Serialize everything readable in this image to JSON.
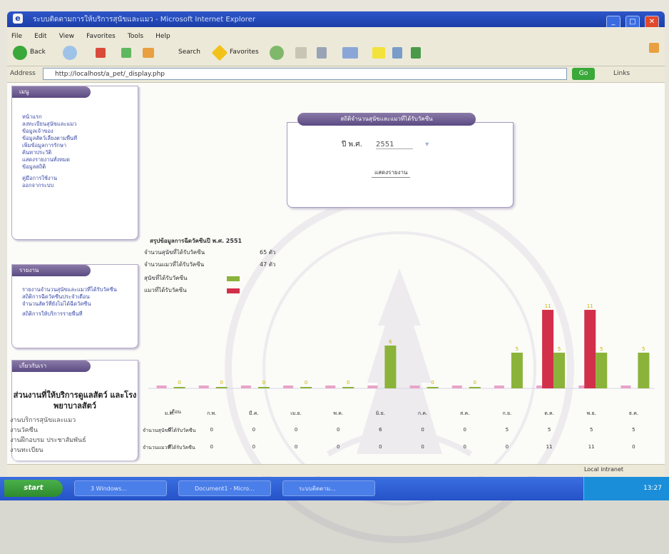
{
  "window": {
    "title": "ระบบติดตามการให้บริการสุนัขและแมว - Microsoft Internet Explorer",
    "controls": [
      "_",
      "□",
      "✕"
    ]
  },
  "menu": [
    "File",
    "Edit",
    "View",
    "Favorites",
    "Tools",
    "Help"
  ],
  "toolbar": {
    "back_label": "Back",
    "search_label": "Search",
    "favorites_label": "Favorites"
  },
  "address": {
    "label": "Address",
    "url": "http://localhost/a_pet/_display.php",
    "go_label": "Go",
    "links_label": "Links"
  },
  "sidebar": {
    "menu_box": {
      "header": "เมนู",
      "items": [
        "หน้าแรก",
        "ลงทะเบียนสุนัขและแมว",
        "ข้อมูลเจ้าของ",
        "ข้อมูลสัตว์เลี้ยงตามพื้นที่",
        "เพิ่มข้อมูลการรักษา",
        "ค้นหาประวัติ",
        "แสดงรายงานทั้งหมด",
        "ข้อมูลสถิติ",
        "คู่มือการใช้งาน",
        "ออกจากระบบ"
      ]
    },
    "report_box": {
      "header": "รายงาน",
      "items": [
        "รายงานจำนวนสุนัขและแมวที่ได้รับวัคซีน",
        "สถิติการฉีดวัคซีนประจำเดือน",
        "จำนวนสัตว์ที่ยังไม่ได้ฉีดวัคซีน",
        "สถิติการให้บริการรายพื้นที่"
      ]
    },
    "about_box": {
      "header": "เกี่ยวกับเรา"
    },
    "thai_heading": "ส่วนงานที่ให้บริการดูแลสัตว์ และโรงพยาบาลสัตว์",
    "thai_items": [
      "งานบริการสุนัขและแมว",
      "งานวัคซีน",
      "งานฝึกอบรม ประชาสัมพันธ์",
      "งานทะเบียน"
    ]
  },
  "panel": {
    "header": "สถิติจำนวนสุนัขและแมวที่ได้รับวัคซีน",
    "year_label": "ปี พ.ศ.",
    "year_value": "2551",
    "button_label": "แสดงรายงาน"
  },
  "summary": {
    "title": "สรุปข้อมูลการฉีดวัคซีนปี พ.ศ. 2551",
    "row1_label": "จำนวนสุนัขที่ได้รับวัคซีน",
    "row1_value": "65 ตัว",
    "row2_label": "จำนวนแมวที่ได้รับวัคซีน",
    "row2_value": "47 ตัว",
    "legend_dog": "สุนัขที่ได้รับวัคซีน",
    "legend_cat": "แมวที่ได้รับวัคซีน",
    "color_dog": "#8bb33a",
    "color_cat": "#d2304a",
    "color_pink": "#e8a3c8"
  },
  "chart_data": {
    "type": "bar",
    "categories": [
      "ม.ค.",
      "ก.พ.",
      "มี.ค.",
      "เม.ย.",
      "พ.ค.",
      "มิ.ย.",
      "ก.ค.",
      "ส.ค.",
      "ก.ย.",
      "ต.ค.",
      "พ.ย.",
      "ธ.ค."
    ],
    "series": [
      {
        "name": "สุนัขที่ได้รับวัคซีน",
        "values": [
          0,
          0,
          0,
          0,
          0,
          6,
          0,
          0,
          5,
          5,
          5,
          5
        ]
      },
      {
        "name": "แมวที่ได้รับวัคซีน",
        "values": [
          0,
          0,
          0,
          0,
          0,
          0,
          0,
          0,
          0,
          11,
          11,
          0
        ]
      }
    ],
    "ylim": [
      0,
      12
    ]
  },
  "table": {
    "header_label": "เดือน",
    "row1_label": "จำนวนสุนัขที่ได้รับวัคซีน",
    "row2_label": "จำนวนแมวที่ได้รับวัคซีน"
  },
  "statusbar": {
    "zone": "Local intranet"
  },
  "taskbar": {
    "start": "start",
    "tasks": [
      "3 Windows...",
      "Document1 - Micro...",
      "ระบบติดตาม..."
    ],
    "clock": "13:27"
  }
}
